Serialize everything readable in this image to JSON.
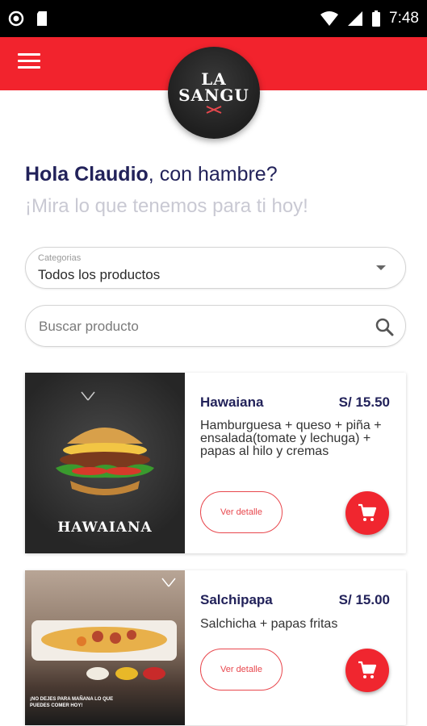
{
  "status_bar": {
    "time": "7:48"
  },
  "header": {
    "logo_line1": "LA",
    "logo_line2": "SANGU"
  },
  "greeting": {
    "name": "Hola Claudio",
    "rest": ", con hambre?",
    "subtitle": "¡Mira lo que tenemos para ti hoy!"
  },
  "category_select": {
    "label": "Categorias",
    "value": "Todos los productos"
  },
  "search": {
    "placeholder": "Buscar producto"
  },
  "products": [
    {
      "name": "Hawaiana",
      "price": "S/ 15.50",
      "description": "Hamburguesa + queso + piña + ensalada(tomate y lechuga) + papas al hilo y cremas",
      "image_caption": "HAWAIANA",
      "detail_label": "Ver detalle"
    },
    {
      "name": "Salchipapa",
      "price": "S/ 15.00",
      "description": "Salchicha + papas fritas",
      "image_caption": "¡NO DEJES PARA MAÑANA LO QUE PUEDES COMER HOY!",
      "detail_label": "Ver detalle"
    }
  ],
  "colors": {
    "primary": "#f2232d",
    "navy": "#22225a"
  },
  "icons": [
    "menu-icon",
    "search-icon",
    "cart-icon",
    "dropdown-arrow-icon",
    "wifi-icon",
    "signal-icon",
    "battery-icon"
  ]
}
